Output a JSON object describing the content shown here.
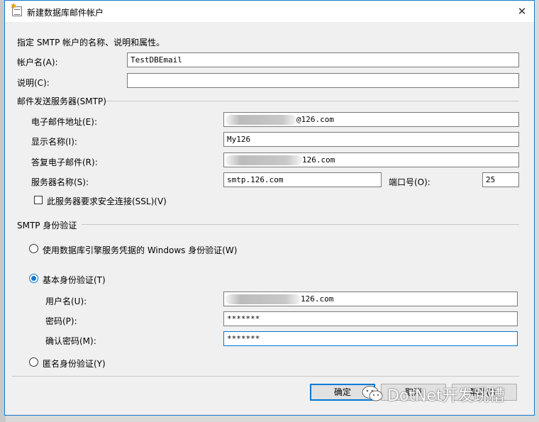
{
  "window": {
    "title": "新建数据库邮件帐户"
  },
  "intro": "指定 SMTP 帐户的名称、说明和属性。",
  "account": {
    "name_label": "帐户名(A):",
    "name_value": "TestDBEmail",
    "desc_label": "说明(C):",
    "desc_value": ""
  },
  "smtp": {
    "section_label": "邮件发送服务器(SMTP)",
    "email_label": "电子邮件地址(E):",
    "email_value": "@126.com",
    "display_label": "显示名称(I):",
    "display_value": "My126",
    "reply_label": "答复电子邮件(R):",
    "reply_value": "126.com",
    "server_label": "服务器名称(S):",
    "server_value": "smtp.126.com",
    "port_label": "端口号(O):",
    "port_value": "25",
    "ssl_label": "此服务器要求安全连接(SSL)(V)"
  },
  "auth": {
    "section_label": "SMTP 身份验证",
    "windows_label": "使用数据库引擎服务凭据的 Windows 身份验证(W)",
    "basic_label": "基本身份验证(T)",
    "username_label": "用户名(U):",
    "username_value": "126.com",
    "password_label": "密码(P):",
    "password_value": "*******",
    "confirm_label": "确认密码(M):",
    "confirm_value": "*******",
    "anon_label": "匿名身份验证(Y)"
  },
  "buttons": {
    "ok": "确定",
    "cancel": "取消",
    "help": "帮助(H)"
  },
  "watermark": "DotNet开发跳槽",
  "colors": {
    "accent": "#0078d7",
    "border": "#1979ca"
  }
}
